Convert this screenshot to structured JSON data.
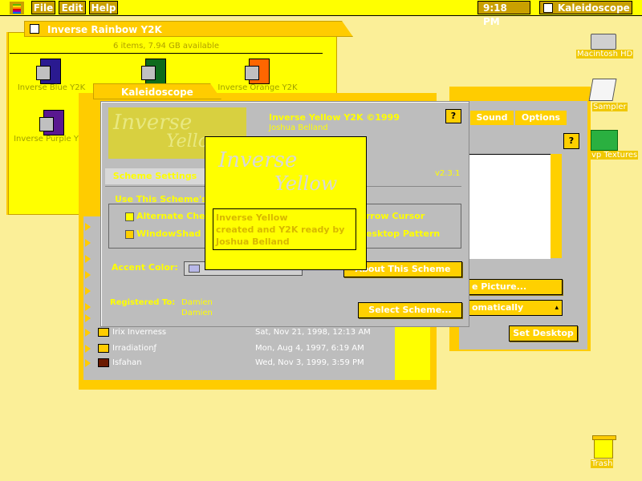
{
  "menubar": {
    "menus": [
      "File",
      "Edit",
      "Help"
    ],
    "clock": "9:18 PM",
    "active_app": "Kaleidoscope"
  },
  "finder_window": {
    "title": "Inverse Rainbow Y2K",
    "info": "6 items, 7.94 GB available",
    "items": [
      {
        "label": "Inverse Blue Y2K",
        "color": "#2a1a90"
      },
      {
        "label": "",
        "color": "#0e6b1c"
      },
      {
        "label": "Inverse Orange Y2K",
        "color": "#ff6600"
      },
      {
        "label": "Inverse Purple Y2K",
        "color": "#5a1890"
      }
    ]
  },
  "kaleidoscope_folder": {
    "title": "Kaleidoscope",
    "files": [
      {
        "name": "Irix Inverness",
        "date": "Sat, Nov 21, 1998, 12:13 AM"
      },
      {
        "name": "Irradiationƒ",
        "date": "Mon, Aug 4, 1997, 6:19 AM"
      },
      {
        "name": "Isfahan",
        "date": "Wed, Nov 3, 1999, 3:59 PM"
      }
    ]
  },
  "scheme_panel": {
    "logo_line1": "Inverse",
    "logo_line2": "Yellow",
    "title": "Inverse Yellow Y2K ©1999",
    "author": "Joshua Belland",
    "version": "v2.3.1",
    "tab_label": "Scheme Settings",
    "group_label": "Use This Scheme's",
    "check_alternate": "Alternate Che",
    "check_windowshade": "WindowShad",
    "check_arrow": "rrow Cursor",
    "check_desktop": "esktop Pattern",
    "accent_label": "Accent Color:",
    "accent_value": "Lavender",
    "about_button": "About This Scheme",
    "registered_label": "Registered To:",
    "registered_name1": "Damien",
    "registered_name2": "Damien",
    "select_button": "Select Scheme..."
  },
  "about_popup": {
    "logo_line1": "Inverse",
    "logo_line2": "Yellow",
    "line1": "Inverse Yellow",
    "line2": "created and Y2K ready by",
    "line3": "Joshua Belland"
  },
  "desktop_prefs": {
    "tab_sound": "Sound",
    "tab_options": "Options",
    "picture_button": "e Picture...",
    "position_value": "omatically",
    "set_button": "Set Desktop"
  },
  "desktop_icons": {
    "hd": "Macintosh HD",
    "sampler": "Sampler",
    "textures": "vp Textures",
    "trash": "Trash"
  }
}
